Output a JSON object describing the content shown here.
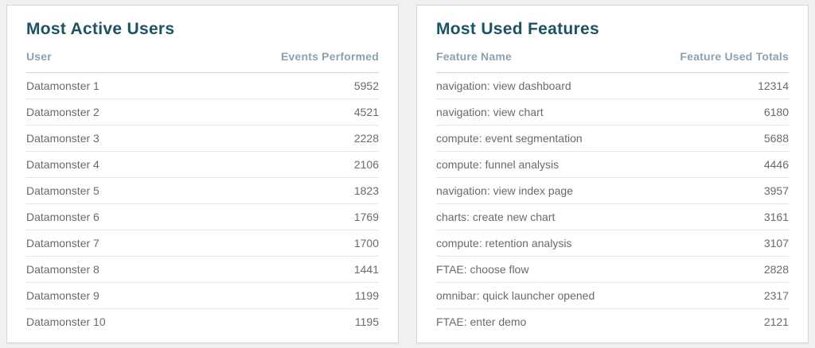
{
  "colors": {
    "page_background": "#f0f0ee",
    "card_background": "#ffffff",
    "card_border": "#d8d8d8",
    "title_text": "#1c5364",
    "column_header_text": "#8ba2ae",
    "row_text": "#6a6a6a",
    "header_divider": "#d3d7d9",
    "row_divider": "#e4e4e4"
  },
  "panels": [
    {
      "title": "Most Active Users",
      "columns": [
        "User",
        "Events Performed"
      ],
      "rows": [
        [
          "Datamonster 1",
          "5952"
        ],
        [
          "Datamonster 2",
          "4521"
        ],
        [
          "Datamonster 3",
          "2228"
        ],
        [
          "Datamonster 4",
          "2106"
        ],
        [
          "Datamonster 5",
          "1823"
        ],
        [
          "Datamonster 6",
          "1769"
        ],
        [
          "Datamonster 7",
          "1700"
        ],
        [
          "Datamonster 8",
          "1441"
        ],
        [
          "Datamonster 9",
          "1199"
        ],
        [
          "Datamonster 10",
          "1195"
        ]
      ]
    },
    {
      "title": "Most Used Features",
      "columns": [
        "Feature Name",
        "Feature Used Totals"
      ],
      "rows": [
        [
          "navigation: view dashboard",
          "12314"
        ],
        [
          "navigation: view chart",
          "6180"
        ],
        [
          "compute: event segmentation",
          "5688"
        ],
        [
          "compute: funnel analysis",
          "4446"
        ],
        [
          "navigation: view index page",
          "3957"
        ],
        [
          "charts: create new chart",
          "3161"
        ],
        [
          "compute: retention analysis",
          "3107"
        ],
        [
          "FTAE: choose flow",
          "2828"
        ],
        [
          "omnibar: quick launcher opened",
          "2317"
        ],
        [
          "FTAE: enter demo",
          "2121"
        ]
      ]
    }
  ]
}
